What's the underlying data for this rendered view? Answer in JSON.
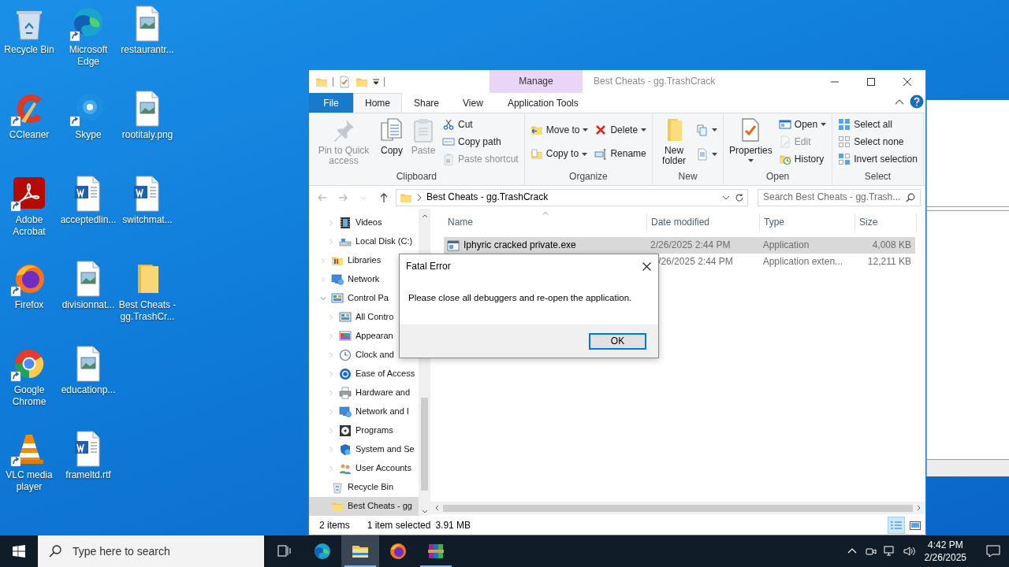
{
  "desktop": {
    "icons": [
      {
        "label": "Recycle Bin",
        "kind": "recycle-bin",
        "shortcut": false
      },
      {
        "label": "CCleaner",
        "kind": "ccleaner",
        "shortcut": true
      },
      {
        "label": "Adobe Acrobat",
        "kind": "acrobat",
        "shortcut": true
      },
      {
        "label": "Firefox",
        "kind": "firefox",
        "shortcut": true
      },
      {
        "label": "Google Chrome",
        "kind": "chrome",
        "shortcut": true
      },
      {
        "label": "VLC media player",
        "kind": "vlc",
        "shortcut": true
      },
      {
        "label": "Microsoft Edge",
        "kind": "edge",
        "shortcut": true
      },
      {
        "label": "Skype",
        "kind": "skype",
        "shortcut": true
      },
      {
        "label": "acceptedlin...",
        "kind": "word",
        "shortcut": false
      },
      {
        "label": "divisionnat...",
        "kind": "image",
        "shortcut": false
      },
      {
        "label": "educationp...",
        "kind": "image",
        "shortcut": false
      },
      {
        "label": "frameltd.rtf",
        "kind": "word",
        "shortcut": false
      },
      {
        "label": "restaurantr...",
        "kind": "image",
        "shortcut": false
      },
      {
        "label": "rootitaly.png",
        "kind": "image",
        "shortcut": false
      },
      {
        "label": "switchmat...",
        "kind": "word",
        "shortcut": false
      },
      {
        "label": "Best Cheats - gg.TrashCr...",
        "kind": "folder",
        "shortcut": false
      }
    ]
  },
  "explorer": {
    "title": "Best Cheats - gg.TrashCrack",
    "context_tab": {
      "label": "Manage"
    },
    "tabs": [
      {
        "label": "File",
        "kind": "file",
        "selected": false
      },
      {
        "label": "Home",
        "kind": "normal",
        "selected": true
      },
      {
        "label": "Share",
        "kind": "normal",
        "selected": false
      },
      {
        "label": "View",
        "kind": "normal",
        "selected": false
      },
      {
        "label": "Application Tools",
        "kind": "contextual",
        "selected": false
      }
    ],
    "ribbon": {
      "groups": [
        {
          "label": "Clipboard",
          "columns": [
            [
              {
                "label": "Pin to Quick access",
                "kind": "pin",
                "disabled": true
              }
            ],
            [
              {
                "label": "Copy",
                "kind": "copy",
                "disabled": false
              }
            ],
            [
              {
                "label": "Paste",
                "kind": "paste",
                "disabled": true
              }
            ],
            [
              {
                "label": "Cut",
                "kind": "cut",
                "disabled": false
              },
              {
                "label": "Copy path",
                "kind": "copy-path",
                "disabled": false
              },
              {
                "label": "Paste shortcut",
                "kind": "paste-shortcut",
                "disabled": true
              }
            ]
          ]
        },
        {
          "label": "Organize",
          "columns": [
            [
              {
                "label": "Move to",
                "kind": "move-to",
                "disabled": false,
                "dropdown": true
              },
              {
                "label": "Copy to",
                "kind": "copy-to",
                "disabled": false,
                "dropdown": true
              }
            ],
            [
              {
                "label": "Delete",
                "kind": "delete",
                "disabled": false,
                "dropdown": true
              },
              {
                "label": "Rename",
                "kind": "rename",
                "disabled": false
              }
            ]
          ]
        },
        {
          "label": "New",
          "columns": [
            [
              {
                "label": "New folder",
                "kind": "new-folder",
                "disabled": false
              }
            ],
            [
              {
                "kind": "new-item",
                "disabled": false,
                "dropdown": true
              },
              {
                "kind": "easy-access",
                "disabled": false,
                "dropdown": true
              }
            ]
          ]
        },
        {
          "label": "Open",
          "columns": [
            [
              {
                "label": "Properties",
                "kind": "properties",
                "disabled": false,
                "dropdown": true
              }
            ],
            [
              {
                "label": "Open",
                "kind": "open",
                "disabled": false,
                "dropdown": true
              },
              {
                "label": "Edit",
                "kind": "edit",
                "disabled": true
              },
              {
                "label": "History",
                "kind": "history",
                "disabled": false
              }
            ]
          ]
        },
        {
          "label": "Select",
          "columns": [
            [
              {
                "label": "Select all",
                "kind": "select-all",
                "disabled": false
              },
              {
                "label": "Select none",
                "kind": "select-none",
                "disabled": false
              },
              {
                "label": "Invert selection",
                "kind": "invert-selection",
                "disabled": false
              }
            ]
          ]
        }
      ]
    },
    "address": {
      "path": "Best Cheats - gg.TrashCrack"
    },
    "search": {
      "placeholder": "Search Best Cheats - gg.Trash..."
    },
    "nav_pane": {
      "items": [
        {
          "children": [
            {
              "label": "Videos",
              "kind": "videos",
              "expanded": false,
              "selected": false
            },
            {
              "label": "Local Disk (C:)",
              "kind": "drive",
              "expanded": false,
              "selected": false
            }
          ]
        },
        {
          "label": "Libraries",
          "kind": "library",
          "expanded": false,
          "selected": false
        },
        {
          "label": "Network",
          "kind": "network",
          "expanded": false,
          "selected": false
        },
        {
          "label": "Control Pa",
          "kind": "control-panel",
          "expanded": true,
          "selected": false,
          "children": [
            {
              "label": "All Contro",
              "kind": "control-panel",
              "expanded": false,
              "selected": false
            },
            {
              "label": "Appearan",
              "kind": "appearance",
              "expanded": false,
              "selected": false
            },
            {
              "label": "Clock and",
              "kind": "clock",
              "expanded": false,
              "selected": false
            },
            {
              "label": "Ease of Access",
              "kind": "ease",
              "expanded": false,
              "selected": false
            },
            {
              "label": "Hardware and",
              "kind": "hardware",
              "expanded": false,
              "selected": false
            },
            {
              "label": "Network and I",
              "kind": "network",
              "expanded": false,
              "selected": false
            },
            {
              "label": "Programs",
              "kind": "programs",
              "expanded": false,
              "selected": false
            },
            {
              "label": "System and Se",
              "kind": "system",
              "expanded": false,
              "selected": false
            },
            {
              "label": "User Accounts",
              "kind": "users",
              "expanded": false,
              "selected": false
            }
          ]
        },
        {
          "label": "Recycle Bin",
          "kind": "recycle-bin",
          "selected": false
        },
        {
          "label": "Best Cheats - gg",
          "kind": "folder",
          "selected": true
        }
      ]
    },
    "file_list": {
      "columns": [
        "Name",
        "Date modified",
        "Type",
        "Size"
      ],
      "rows": [
        {
          "name": "Iphyric cracked private.exe",
          "kind": "application",
          "date": "2/26/2025 2:44 PM",
          "type": "Application",
          "size": "4,008 KB",
          "selected": true
        },
        {
          "date": "/26/2025 2:44 PM",
          "type": "Application exten...",
          "size": "12,211 KB",
          "selected": false
        }
      ]
    },
    "status_bar": {
      "item_count": "2 items",
      "selection": "1 item selected",
      "selection_size": "3.91 MB",
      "views": [
        {
          "kind": "details",
          "selected": true
        },
        {
          "kind": "large-icons",
          "selected": false
        }
      ]
    }
  },
  "dialog": {
    "title": "Fatal Error",
    "message": "Please close all debuggers and re-open the application.",
    "button": "OK"
  },
  "taskbar": {
    "search": {
      "placeholder": "Type here to search"
    },
    "apps": [
      {
        "kind": "edge",
        "active": false,
        "running": false
      },
      {
        "kind": "explorer",
        "active": true,
        "running": true
      },
      {
        "kind": "firefox",
        "active": false,
        "running": false
      },
      {
        "kind": "winrar",
        "active": false,
        "running": true
      }
    ],
    "clock": {
      "time": "4:42 PM",
      "date": "2/26/2025"
    }
  }
}
